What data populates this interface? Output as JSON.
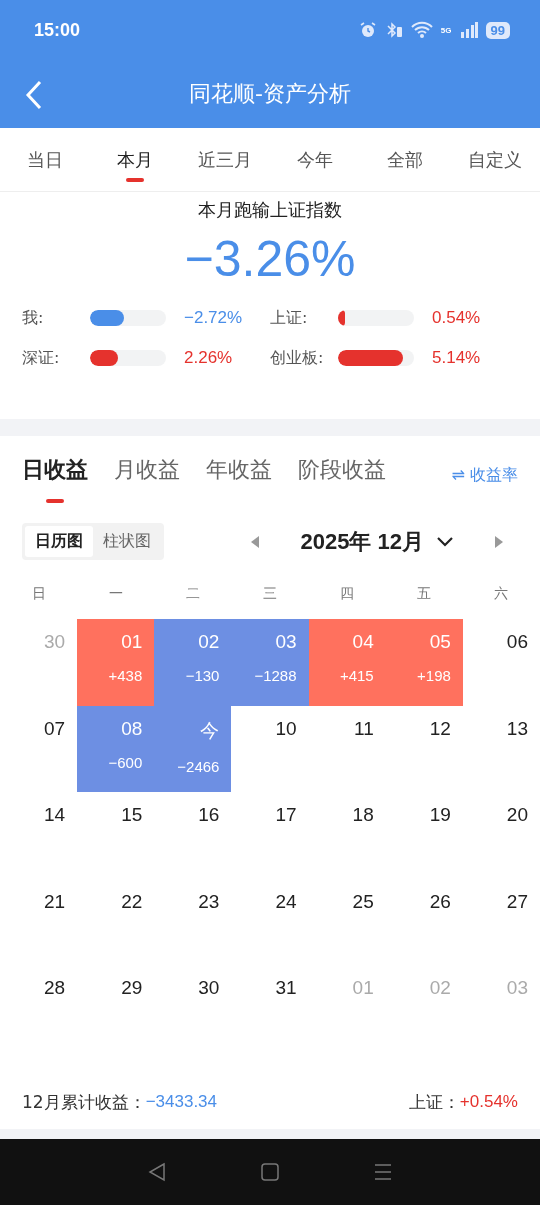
{
  "status_bar": {
    "time": "15:00",
    "battery": "99",
    "network": "5G"
  },
  "header": {
    "title": "同花顺-资产分析"
  },
  "period_tabs": [
    {
      "label": "当日",
      "selected": false
    },
    {
      "label": "本月",
      "selected": true
    },
    {
      "label": "近三月",
      "selected": false
    },
    {
      "label": "今年",
      "selected": false
    },
    {
      "label": "全部",
      "selected": false
    },
    {
      "label": "自定义",
      "selected": false
    }
  ],
  "summary": {
    "title": "本月跑输上证指数",
    "value": "−3.26%",
    "comparisons": [
      {
        "label": "我:",
        "level": 0.45,
        "value": "−2.72%",
        "color": "#4a8ee8"
      },
      {
        "label": "上证:",
        "level": 0.09,
        "value": "0.54%",
        "color": "#e5322d"
      },
      {
        "label": "深证:",
        "level": 0.37,
        "value": "2.26%",
        "color": "#e5322d"
      },
      {
        "label": "创业板:",
        "level": 0.85,
        "value": "5.14%",
        "color": "#e5322d"
      }
    ]
  },
  "profit_tabs": [
    {
      "label": "日收益",
      "selected": true
    },
    {
      "label": "月收益",
      "selected": false
    },
    {
      "label": "年收益",
      "selected": false
    },
    {
      "label": "阶段收益",
      "selected": false
    }
  ],
  "rate_toggle": {
    "icon": "⇌",
    "label": "收益率"
  },
  "view_toggle": [
    {
      "label": "日历图",
      "selected": true
    },
    {
      "label": "柱状图",
      "selected": false
    }
  ],
  "month_picker": {
    "label": "2025年 12月"
  },
  "weekdays": [
    "日",
    "一",
    "二",
    "三",
    "四",
    "五",
    "六"
  ],
  "calendar": [
    [
      {
        "day": "30",
        "kind": "muted"
      },
      {
        "day": "01",
        "value": "+438",
        "kind": "gain"
      },
      {
        "day": "02",
        "value": "−130",
        "kind": "loss"
      },
      {
        "day": "03",
        "value": "−1288",
        "kind": "loss"
      },
      {
        "day": "04",
        "value": "+415",
        "kind": "gain"
      },
      {
        "day": "05",
        "value": "+198",
        "kind": "gain"
      },
      {
        "day": "06",
        "kind": "plain"
      }
    ],
    [
      {
        "day": "07",
        "kind": "plain"
      },
      {
        "day": "08",
        "value": "−600",
        "kind": "loss"
      },
      {
        "day": "今",
        "value": "−2466",
        "kind": "loss"
      },
      {
        "day": "10",
        "kind": "plain"
      },
      {
        "day": "11",
        "kind": "plain"
      },
      {
        "day": "12",
        "kind": "plain"
      },
      {
        "day": "13",
        "kind": "plain"
      }
    ],
    [
      {
        "day": "14",
        "kind": "plain"
      },
      {
        "day": "15",
        "kind": "plain"
      },
      {
        "day": "16",
        "kind": "plain"
      },
      {
        "day": "17",
        "kind": "plain"
      },
      {
        "day": "18",
        "kind": "plain"
      },
      {
        "day": "19",
        "kind": "plain"
      },
      {
        "day": "20",
        "kind": "plain"
      }
    ],
    [
      {
        "day": "21",
        "kind": "plain"
      },
      {
        "day": "22",
        "kind": "plain"
      },
      {
        "day": "23",
        "kind": "plain"
      },
      {
        "day": "24",
        "kind": "plain"
      },
      {
        "day": "25",
        "kind": "plain"
      },
      {
        "day": "26",
        "kind": "plain"
      },
      {
        "day": "27",
        "kind": "plain"
      }
    ],
    [
      {
        "day": "28",
        "kind": "plain"
      },
      {
        "day": "29",
        "kind": "plain"
      },
      {
        "day": "30",
        "kind": "plain"
      },
      {
        "day": "31",
        "kind": "plain"
      },
      {
        "day": "01",
        "kind": "muted"
      },
      {
        "day": "02",
        "kind": "muted"
      },
      {
        "day": "03",
        "kind": "muted"
      }
    ]
  ],
  "footer": {
    "total_label": "12月累计收益：",
    "total_value": "−3433.34",
    "index_label": "上证：",
    "index_value": "+0.54%"
  }
}
